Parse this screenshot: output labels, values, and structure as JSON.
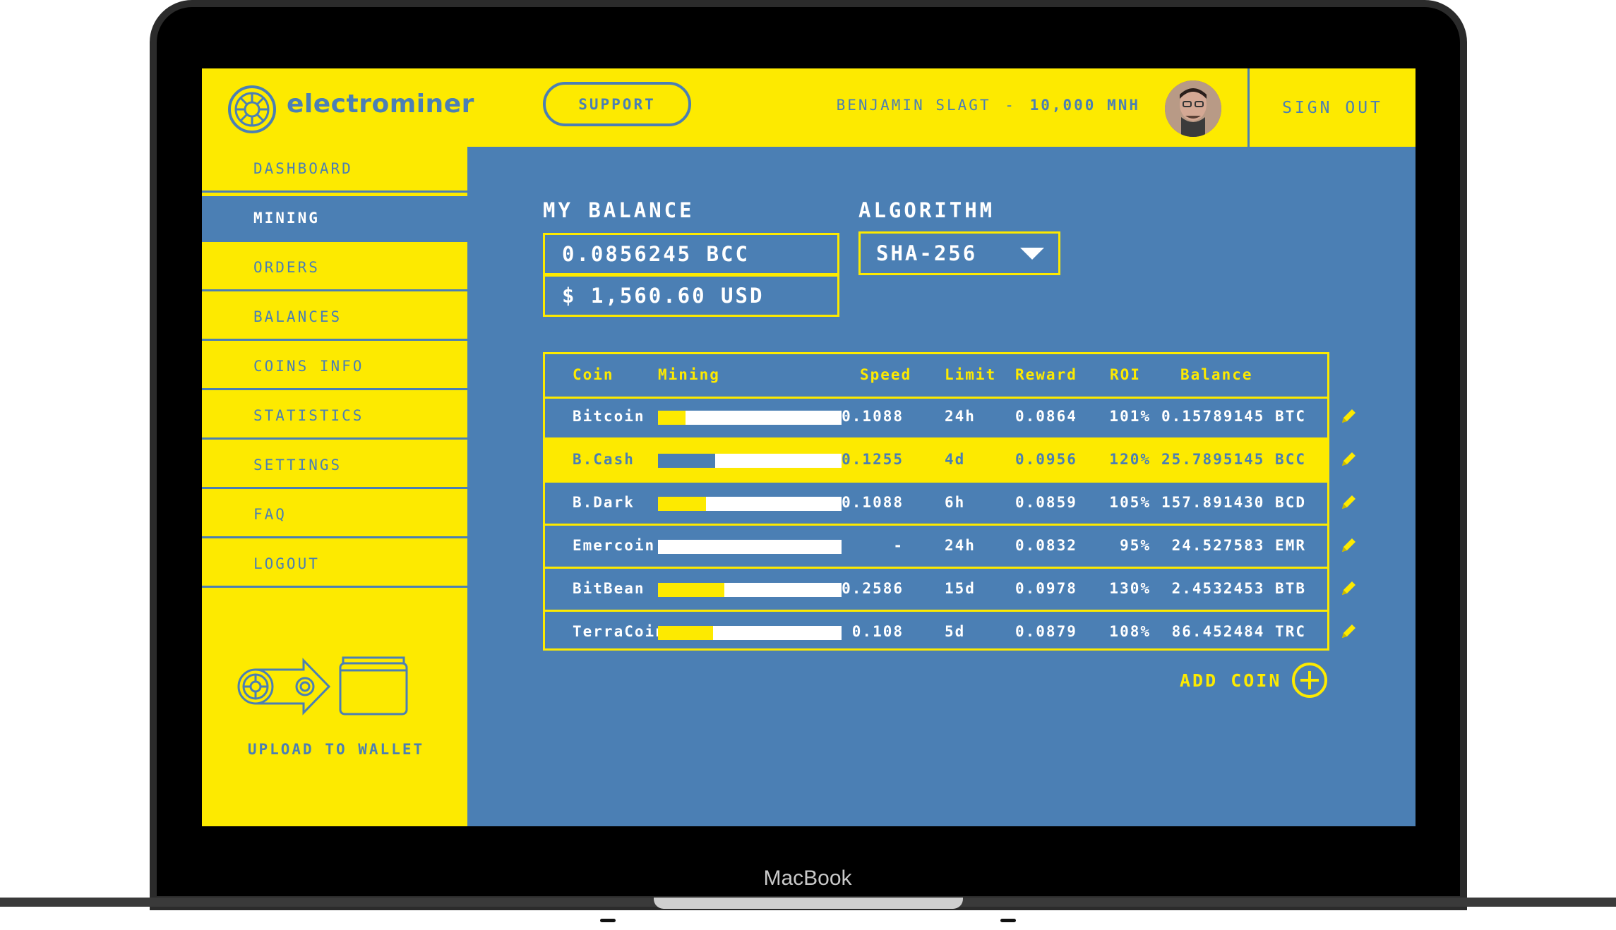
{
  "device": {
    "brand": "MacBook"
  },
  "header": {
    "logo_text": "electrominer",
    "support_label": "SUPPORT",
    "user_name": "BENJAMIN SLAGT",
    "user_separator": "-",
    "user_balance": "10,000 MNH",
    "signout_label": "SIGN OUT"
  },
  "sidebar": {
    "items": [
      {
        "label": "DASHBOARD",
        "active": false
      },
      {
        "label": "MINING",
        "active": true
      },
      {
        "label": "ORDERS",
        "active": false
      },
      {
        "label": "BALANCES",
        "active": false
      },
      {
        "label": "COINS INFO",
        "active": false
      },
      {
        "label": "STATISTICS",
        "active": false
      },
      {
        "label": "SETTINGS",
        "active": false
      },
      {
        "label": "FAQ",
        "active": false
      },
      {
        "label": "LOGOUT",
        "active": false
      }
    ],
    "upload_label": "UPLOAD TO WALLET"
  },
  "balance": {
    "title": "MY BALANCE",
    "coin_amount": "0.0856245 BCC",
    "usd_amount": "$ 1,560.60 USD"
  },
  "algorithm": {
    "title": "ALGORITHM",
    "selected": "SHA-256"
  },
  "table": {
    "headers": {
      "coin": "Coin",
      "mining": "Mining",
      "speed": "Speed",
      "limit": "Limit",
      "reward": "Reward",
      "roi": "ROI",
      "balance": "Balance"
    },
    "rows": [
      {
        "coin": "Bitcoin",
        "mining_progress": 0.15,
        "speed": "0.1088",
        "limit": "24h",
        "reward": "0.0864",
        "roi": "101%",
        "balance": "0.15789145 BTC",
        "highlight": false
      },
      {
        "coin": "B.Cash",
        "mining_progress": 0.31,
        "speed": "0.1255",
        "limit": "4d",
        "reward": "0.0956",
        "roi": "120%",
        "balance": "25.7895145 BCC",
        "highlight": true
      },
      {
        "coin": "B.Dark",
        "mining_progress": 0.26,
        "speed": "0.1088",
        "limit": "6h",
        "reward": "0.0859",
        "roi": "105%",
        "balance": "157.891430 BCD",
        "highlight": false
      },
      {
        "coin": "Emercoin",
        "mining_progress": 0.0,
        "speed": "-",
        "limit": "24h",
        "reward": "0.0832",
        "roi": "95%",
        "balance": "24.527583 EMR",
        "highlight": false
      },
      {
        "coin": "BitBean",
        "mining_progress": 0.36,
        "speed": "0.2586",
        "limit": "15d",
        "reward": "0.0978",
        "roi": "130%",
        "balance": "2.4532453 BTB",
        "highlight": false
      },
      {
        "coin": "TerraCoin",
        "mining_progress": 0.3,
        "speed": "0.108",
        "limit": "5d",
        "reward": "0.0879",
        "roi": "108%",
        "balance": "86.452484 TRC",
        "highlight": false
      }
    ]
  },
  "add_coin_label": "ADD COIN",
  "icons": {
    "logo": "crypto-coin-icon",
    "edit": "pencil-icon",
    "add": "plus-circle-icon",
    "dropdown": "caret-down-icon",
    "upload": "coin-to-wallet-icon"
  },
  "colors": {
    "primary_yellow": "#fdea00",
    "primary_blue": "#4b7fb4",
    "text_white": "#ffffff"
  }
}
